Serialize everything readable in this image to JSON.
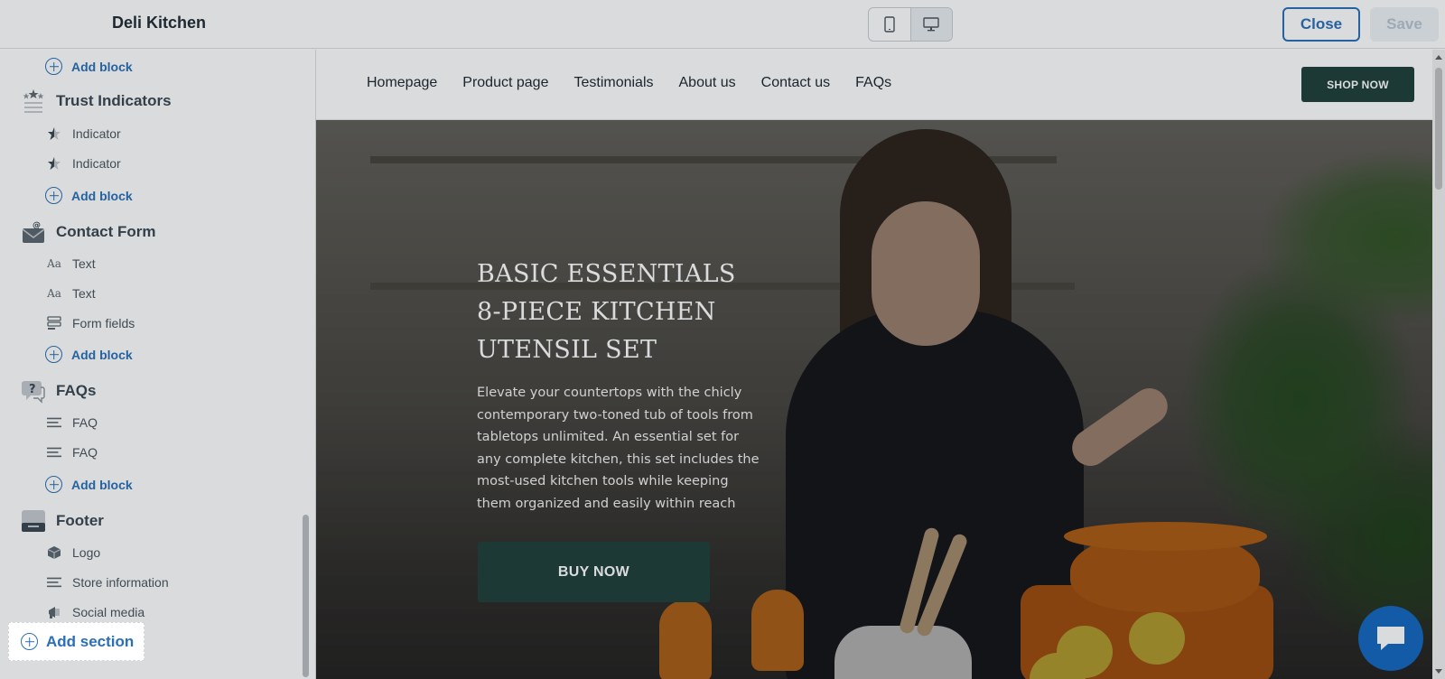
{
  "app": {
    "title": "Deli Kitchen",
    "close_label": "Close",
    "save_label": "Save"
  },
  "device_toggle": [
    "mobile-icon",
    "desktop-icon"
  ],
  "sidebar": {
    "top_add_block": "Add block",
    "sections": [
      {
        "name": "Trust Indicators",
        "icon": "stars-icon",
        "blocks": [
          {
            "label": "Indicator",
            "icon": "star-half-icon"
          },
          {
            "label": "Indicator",
            "icon": "star-half-icon"
          }
        ],
        "add_block": "Add block"
      },
      {
        "name": "Contact Form",
        "icon": "envelope-at-icon",
        "blocks": [
          {
            "label": "Text",
            "icon": "text-aa-icon"
          },
          {
            "label": "Text",
            "icon": "text-aa-icon"
          },
          {
            "label": "Form fields",
            "icon": "form-fields-icon"
          }
        ],
        "add_block": "Add block"
      },
      {
        "name": "FAQs",
        "icon": "question-bubble-icon",
        "blocks": [
          {
            "label": "FAQ",
            "icon": "lines-icon"
          },
          {
            "label": "FAQ",
            "icon": "lines-icon"
          }
        ],
        "add_block": "Add block"
      },
      {
        "name": "Footer",
        "icon": "footer-icon",
        "blocks": [
          {
            "label": "Logo",
            "icon": "cube-icon"
          },
          {
            "label": "Store information",
            "icon": "lines-icon"
          },
          {
            "label": "Social media",
            "icon": "megaphone-icon"
          }
        ]
      }
    ],
    "add_section": "Add section"
  },
  "preview": {
    "nav_links": [
      "Homepage",
      "Product page",
      "Testimonials",
      "About us",
      "Contact us",
      "FAQs"
    ],
    "shop_now": "SHOP NOW",
    "hero": {
      "title_lines": [
        "BASIC ESSENTIALS",
        "8-PIECE KITCHEN",
        "UTENSIL SET"
      ],
      "description_lines": [
        "Elevate your countertops with the chicly",
        "contemporary two-toned tub of tools from",
        "tabletops unlimited. An essential set for",
        "any complete kitchen, this set includes the",
        "most-used kitchen tools while keeping",
        "them organized and easily within reach"
      ],
      "button": "BUY NOW"
    },
    "chat_icon": "chat-icon"
  },
  "colors": {
    "accent_blue": "#2a6fb7",
    "brand_green": "#1e3f38",
    "chat_blue": "#1466c0"
  }
}
